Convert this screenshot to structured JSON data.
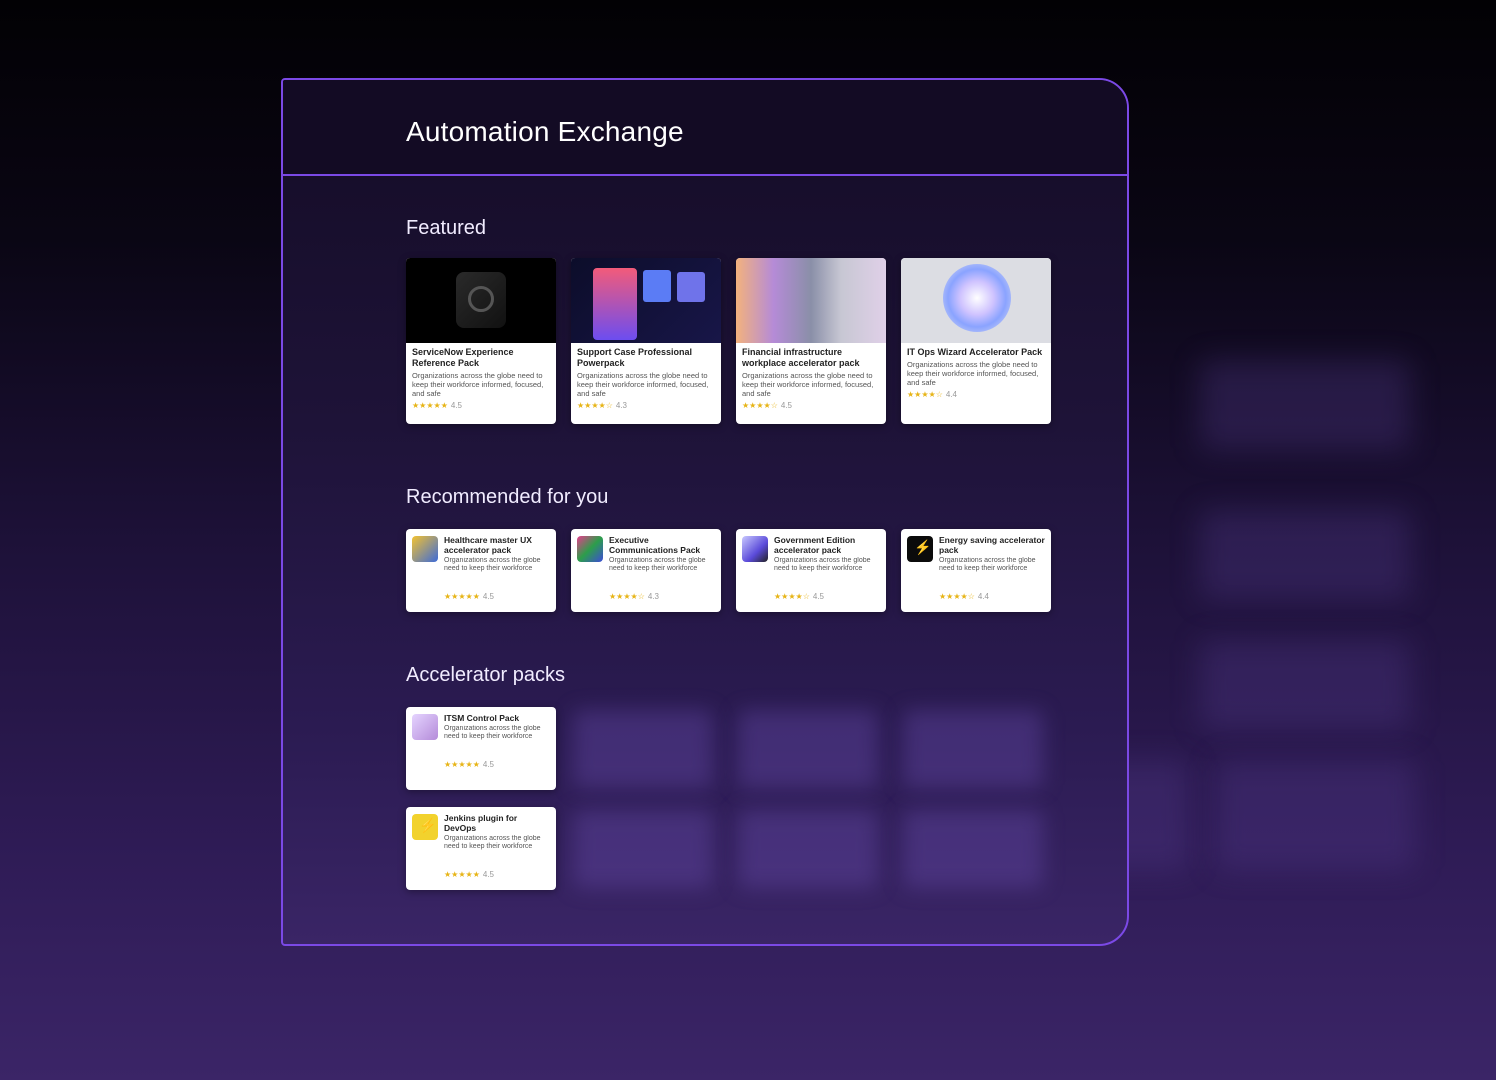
{
  "panel": {
    "title": "Automation Exchange"
  },
  "sections": {
    "featured": "Featured",
    "recommended": "Recommended for you",
    "accelerator": "Accelerator packs"
  },
  "featured": [
    {
      "name": "ServiceNow Experience Reference Pack",
      "desc": "Organizations across the globe need to keep their workforce informed, focused, and safe",
      "rating": "★★★★★",
      "score": "4.5",
      "thumb": "black-logo"
    },
    {
      "name": "Support Case Professional Powerpack",
      "desc": "Organizations across the globe need to keep their workforce informed, focused, and safe",
      "rating": "★★★★☆",
      "score": "4.3",
      "thumb": "app-screens"
    },
    {
      "name": "Financial infrastructure workplace accelerator pack",
      "desc": "Organizations across the globe need to keep their workforce informed, focused, and safe",
      "rating": "★★★★☆",
      "score": "4.5",
      "thumb": "abstract-lines"
    },
    {
      "name": "IT Ops Wizard Accelerator Pack",
      "desc": "Organizations across the globe need to keep their workforce informed, focused, and safe",
      "rating": "★★★★☆",
      "score": "4.4",
      "thumb": "gradient-orb"
    }
  ],
  "recommended": [
    {
      "name": "Healthcare master UX accelerator pack",
      "desc": "Organizations across the globe need to keep their workforce",
      "rating": "★★★★★",
      "score": "4.5"
    },
    {
      "name": "Executive Communications Pack",
      "desc": "Organizations across the globe need to keep their workforce",
      "rating": "★★★★☆",
      "score": "4.3"
    },
    {
      "name": "Government Edition accelerator pack",
      "desc": "Organizations across the globe need to keep their workforce",
      "rating": "★★★★☆",
      "score": "4.5"
    },
    {
      "name": "Energy saving accelerator pack",
      "desc": "Organizations across the globe need to keep their workforce",
      "rating": "★★★★☆",
      "score": "4.4"
    }
  ],
  "accelerator": [
    {
      "name": "ITSM Control Pack",
      "desc": "Organizations across the globe need to keep their workforce",
      "rating": "★★★★★",
      "score": "4.5"
    },
    {
      "name": "Jenkins plugin for DevOps",
      "desc": "Organizations across the globe need to keep their workforce",
      "rating": "★★★★★",
      "score": "4.5"
    }
  ],
  "colors": {
    "accent": "#7b49e6",
    "star": "#e7b416",
    "panel_header": "#130b24"
  }
}
